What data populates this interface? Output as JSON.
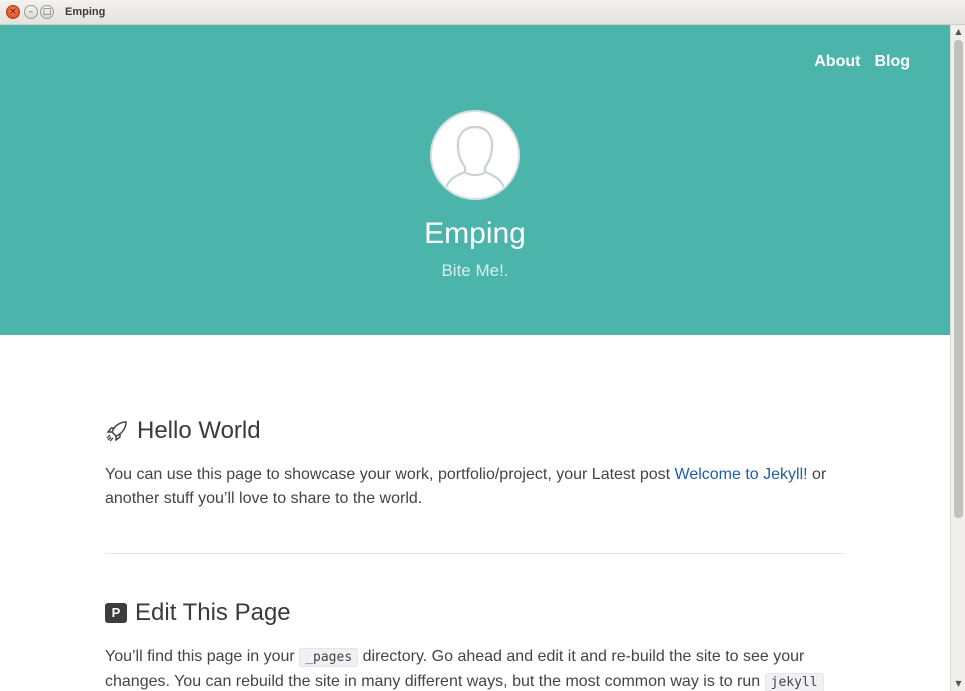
{
  "window": {
    "title": "Emping",
    "close_glyph": "×",
    "min_glyph": "–",
    "max_glyph": "□"
  },
  "nav": {
    "items": [
      "About",
      "Blog"
    ]
  },
  "hero": {
    "title": "Emping",
    "subtitle": "Bite Me!.",
    "avatar_icon": "user-silhouette-icon",
    "background": "#4bb5ab"
  },
  "sections": [
    {
      "icon": "rocket-icon",
      "heading": "Hello World",
      "text_before": "You can use this page to showcase your work, portfolio/project, your Latest post ",
      "link": "Welcome to Jekyll!",
      "text_after": " or another stuff you’ll love to share to the world."
    },
    {
      "icon": "parking-p-icon",
      "icon_letter": "P",
      "heading": "Edit This Page",
      "text_1": "You’ll find this page in your ",
      "code_1": "_pages",
      "text_2": " directory. Go ahead and edit it and re-build the site to see your changes. You can rebuild the site in many different ways, but the most common way is to run ",
      "code_2": "jekyll"
    }
  ],
  "colors": {
    "accent": "#4bb5ab",
    "link": "#1c5fa8"
  }
}
